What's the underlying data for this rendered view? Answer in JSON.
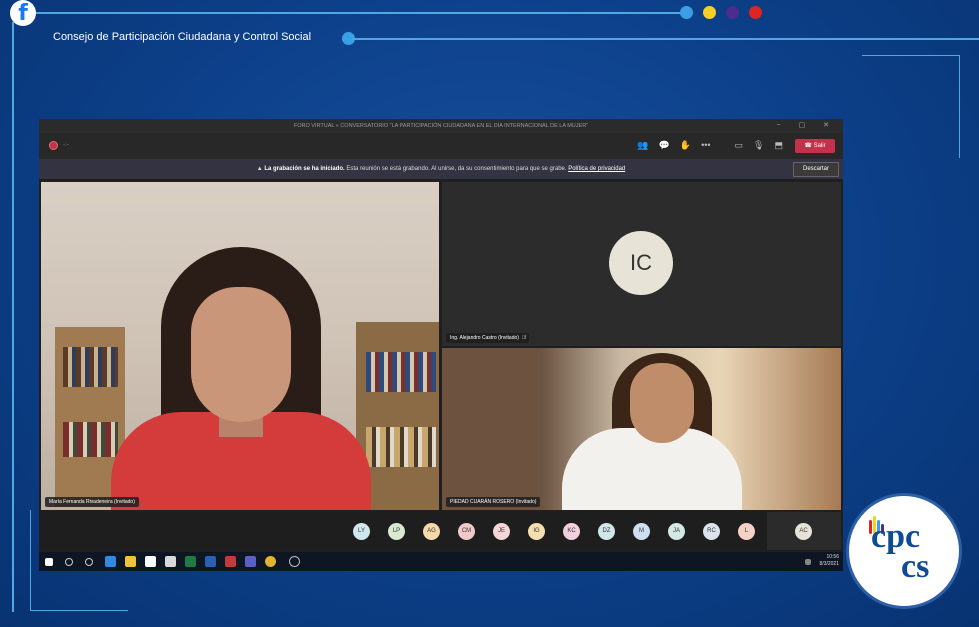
{
  "header": {
    "organization": "Consejo de Participación Ciudadana y Control Social",
    "social_icon": "facebook-icon",
    "dot_colors": [
      "#3aa0e6",
      "#f5d020",
      "#4b2c8f",
      "#e02424"
    ]
  },
  "teams": {
    "window_title": "FORO VIRTUAL « CONVERSATORIO \"LA PARTICIPACIÓN CIUDADANA EN EL DÍA INTERNACIONAL DE LA MUJER\"",
    "recording_time": "-:-",
    "leave_label": "Salir",
    "banner": {
      "bold": "La grabación se ha iniciado.",
      "text": "Esta reunión se está grabando. Al unirse, da su consentimiento para que se grabe.",
      "link": "Política de privacidad",
      "dismiss": "Descartar"
    },
    "videos": {
      "main_name": "María Fernanda Rivadeneira (Invitado)",
      "ic_name": "Ing. Alejandro Castro (Invitado)",
      "ic_initials": "IC",
      "third_name": "PIEDAD CUARÁN ROSERO (Invitado)"
    },
    "participants": [
      {
        "initials": "LY",
        "color": "#cfe7ef"
      },
      {
        "initials": "LP",
        "color": "#d9e9d0"
      },
      {
        "initials": "AG",
        "color": "#f5d9a8"
      },
      {
        "initials": "CM",
        "color": "#f2c9c9"
      },
      {
        "initials": "JE",
        "color": "#f6d6d6"
      },
      {
        "initials": "IG",
        "color": "#f5dfb0"
      },
      {
        "initials": "KC",
        "color": "#f3cfe0"
      },
      {
        "initials": "DZ",
        "color": "#cfe6ea"
      },
      {
        "initials": "M",
        "color": "#cfdff2"
      },
      {
        "initials": "JA",
        "color": "#d4e8e3"
      },
      {
        "initials": "RC",
        "color": "#dde3ee"
      },
      {
        "initials": "L",
        "color": "#f6d2c4"
      }
    ],
    "extra_participant": "AC",
    "clock_time": "10:56",
    "clock_date": "8/3/2021"
  },
  "logo": {
    "line1": "cpc",
    "line2": "cs"
  }
}
